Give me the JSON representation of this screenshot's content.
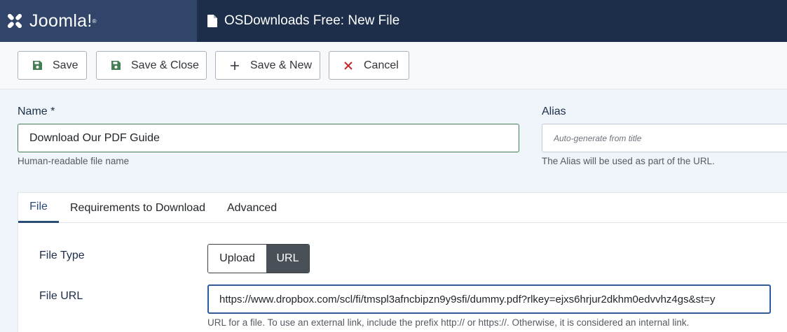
{
  "brand": {
    "name": "Joomla!",
    "registered_mark": "®"
  },
  "header": {
    "title": "OSDownloads Free: New File",
    "title_icon": "file-icon"
  },
  "toolbar": {
    "save_label": "Save",
    "save_close_label": "Save & Close",
    "save_new_label": "Save & New",
    "cancel_label": "Cancel",
    "icon_colors": {
      "save": "#457d54",
      "cancel": "#c52827",
      "plus": "#31343a"
    }
  },
  "form": {
    "name": {
      "label": "Name *",
      "value": "Download Our PDF Guide",
      "help": "Human-readable file name"
    },
    "alias": {
      "label": "Alias",
      "placeholder": "Auto-generate from title",
      "help": "The Alias will be used as part of the URL."
    }
  },
  "tabs": [
    {
      "label": "File",
      "active": true
    },
    {
      "label": "Requirements to Download",
      "active": false
    },
    {
      "label": "Advanced",
      "active": false
    }
  ],
  "file": {
    "type_label": "File Type",
    "type_options": [
      "Upload",
      "URL"
    ],
    "type_selected": "URL",
    "url_label": "File URL",
    "url_value": "https://www.dropbox.com/scl/fi/tmspl3afncbipzn9y9sfi/dummy.pdf?rlkey=ejxs6hrjur2dkhm0edvvhz4gs&st=y",
    "url_help": "URL for a file. To use an external link, include the prefix http:// or https://. Otherwise, it is considered an internal link."
  },
  "colors": {
    "header_bg": "#1c2e4a",
    "logo_bg": "#31456a",
    "accent": "#2a4c78"
  }
}
